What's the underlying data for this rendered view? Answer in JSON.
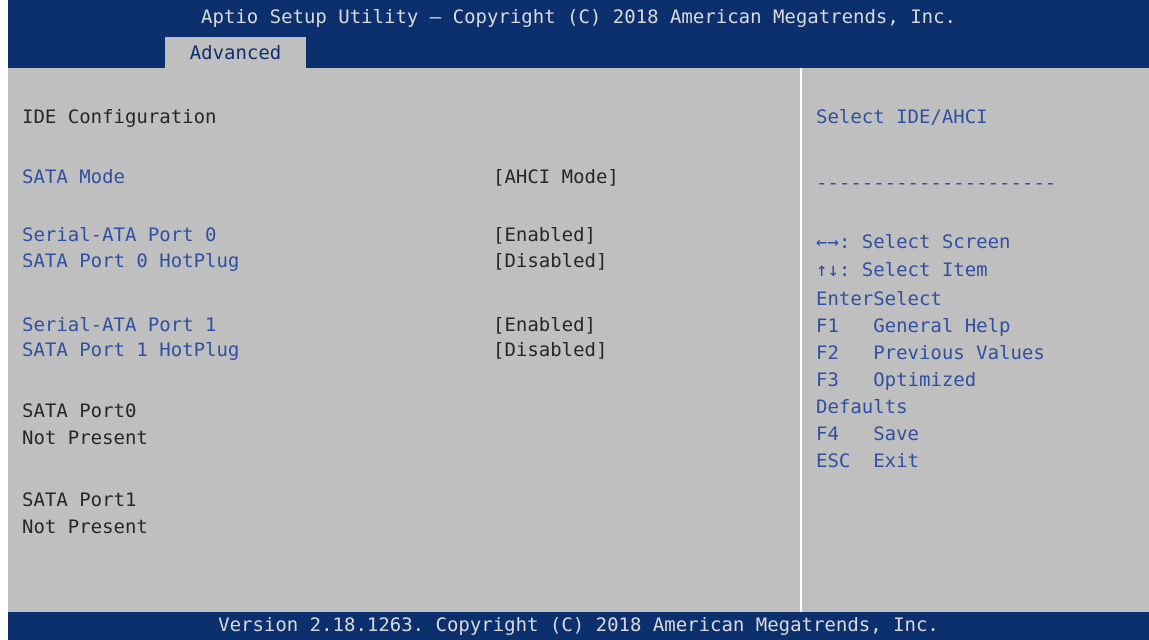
{
  "header": {
    "title": "Aptio Setup Utility – Copyright (C) 2018 American Megatrends, Inc.",
    "tab": "Advanced"
  },
  "main": {
    "section_title": "IDE Configuration",
    "settings": [
      {
        "label": "SATA Mode",
        "value": "[AHCI Mode]"
      },
      {
        "label": "Serial-ATA Port 0",
        "value": "[Enabled]"
      },
      {
        "label": "SATA Port 0 HotPlug",
        "value": "[Disabled]"
      },
      {
        "label": "Serial-ATA Port 1",
        "value": "[Enabled]"
      },
      {
        "label": "SATA Port 1 HotPlug",
        "value": "[Disabled]"
      }
    ],
    "port_info": [
      {
        "name": "SATA Port0",
        "status": "Not Present"
      },
      {
        "name": "SATA Port1",
        "status": "Not Present"
      }
    ]
  },
  "help_panel": {
    "description": "Select IDE/AHCI",
    "separator": "---------------------",
    "keys": [
      "←→: Select Screen",
      "↑↓: Select Item",
      "EnterSelect",
      "F1   General Help",
      "F2   Previous Values",
      "F3   Optimized",
      "Defaults",
      "F4   Save",
      "ESC  Exit"
    ]
  },
  "footer": {
    "text": "Version 2.18.1263. Copyright (C) 2018 American Megatrends, Inc."
  },
  "colors": {
    "frame_blue": "#0c2f6e",
    "panel_gray": "#bfbfbf",
    "item_blue": "#2f4fa0",
    "text_dark": "#262626"
  }
}
